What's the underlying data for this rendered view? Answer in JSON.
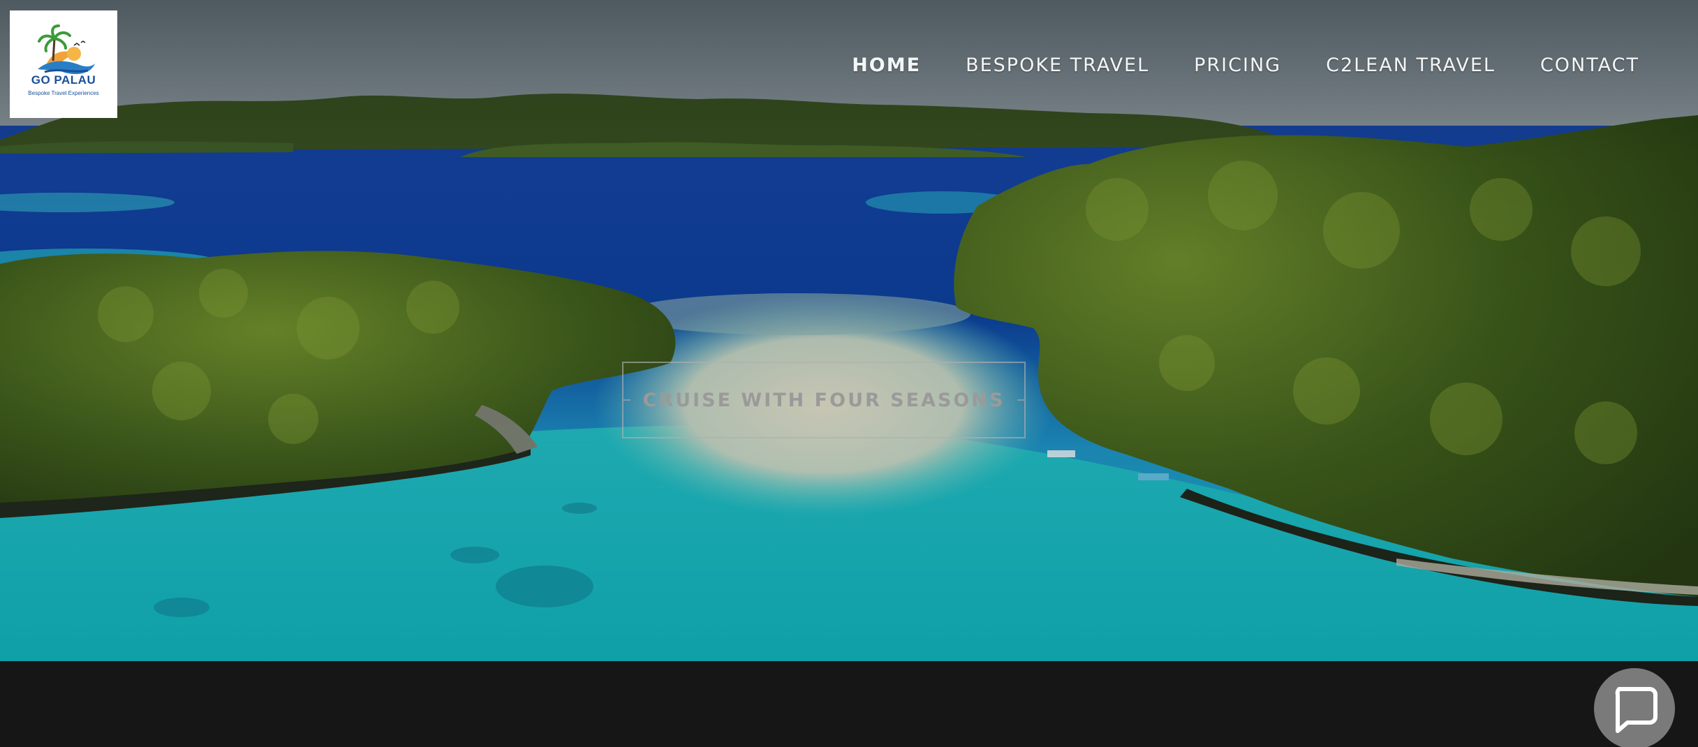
{
  "logo": {
    "name": "GO PALAU",
    "tagline": "Bespoke Travel Experiences"
  },
  "nav": {
    "items": [
      {
        "label": "HOME",
        "active": true
      },
      {
        "label": "BESPOKE TRAVEL",
        "active": false
      },
      {
        "label": "PRICING",
        "active": false
      },
      {
        "label": "C2LEAN TRAVEL",
        "active": false
      },
      {
        "label": "CONTACT",
        "active": false
      }
    ]
  },
  "hero": {
    "cta_label": "CRUISE WITH FOUR SEASONS"
  },
  "chat": {
    "icon": "chat-bubble-icon"
  },
  "colors": {
    "ocean_deep": "#0b3f9e",
    "lagoon": "#17b4b9",
    "island_green": "#3f5e1d",
    "footer_band": "#161616"
  }
}
